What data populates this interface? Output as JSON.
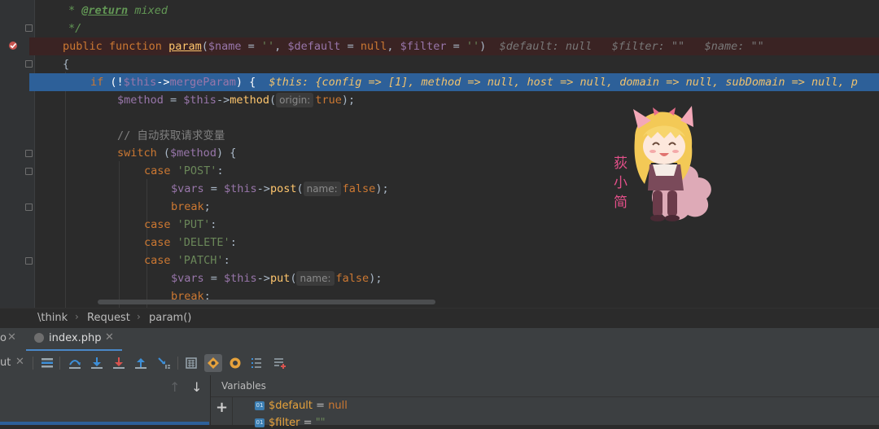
{
  "editor": {
    "lines": {
      "l1": {
        "star": "*",
        "tag": "@return",
        "text": " mixed"
      },
      "l2": {
        "text": "*/"
      },
      "l3": {
        "kw": "public function",
        "fn": "param",
        "p1": "$name",
        "eq1": " = ",
        "s1": "''",
        "c1": ", ",
        "p2": "$default",
        "eq2": " = ",
        "null": "null",
        "c2": ", ",
        "p3": "$filter",
        "eq3": " = ",
        "s3": "''",
        "close": ")",
        "inlay1": "$default: null",
        "inlay2": "$filter: \"\"",
        "inlay3": "$name: \"\""
      },
      "l4": {
        "text": "{"
      },
      "l5": {
        "kw": "if",
        "open": " (!",
        "v": "$this",
        "arrow": "->",
        "prop": "mergeParam",
        "close": ") {",
        "inlay_name": "$this:",
        "inlay_val": "{config => [1], method => null, host => null, domain => null, subDomain => null, p"
      },
      "l6": {
        "v": "$method",
        "eq": " = ",
        "t": "$this",
        "arrow": "->",
        "fn": "method",
        "open": "(",
        "hint": "origin:",
        "val": "true",
        "close": ");"
      },
      "l8": {
        "text": "// 自动获取请求变量"
      },
      "l9": {
        "kw": "switch",
        "open": " (",
        "v": "$method",
        "close": ") {"
      },
      "l10": {
        "kw": "case",
        "str": "'POST'",
        "colon": ":"
      },
      "l11": {
        "v": "$vars",
        "eq": " = ",
        "t": "$this",
        "arrow": "->",
        "fn": "post",
        "open": "(",
        "hint": "name:",
        "val": "false",
        "close": ");"
      },
      "l12": {
        "kw": "break",
        "semi": ";"
      },
      "l13": {
        "kw": "case",
        "str": "'PUT'",
        "colon": ":"
      },
      "l14": {
        "kw": "case",
        "str": "'DELETE'",
        "colon": ":"
      },
      "l15": {
        "kw": "case",
        "str": "'PATCH'",
        "colon": ":"
      },
      "l16": {
        "v": "$vars",
        "eq": " = ",
        "t": "$this",
        "arrow": "->",
        "fn": "put",
        "open": "(",
        "hint": "name:",
        "val": "false",
        "close": ");"
      },
      "l17": {
        "kw": "break",
        "semi": ";"
      }
    },
    "sticker_text": "荻小简"
  },
  "breadcrumbs": [
    "\\think",
    "Request",
    "param()"
  ],
  "tabs": {
    "left_fragment": "o",
    "active": "index.php"
  },
  "toolbar": {
    "left_fragment": "ut"
  },
  "variables": {
    "title": "Variables",
    "items": [
      {
        "badge": "01",
        "name": "$default",
        "eq": " = ",
        "value": "null"
      },
      {
        "badge": "01",
        "name": "$filter",
        "eq": " = ",
        "value": "\"\""
      }
    ]
  },
  "colors": {
    "breakpoint_line": "#3a2323",
    "current_line": "#2d6099",
    "keyword": "#cc7832",
    "variable": "#9876aa",
    "function": "#ffc66d",
    "string": "#6a8759"
  }
}
